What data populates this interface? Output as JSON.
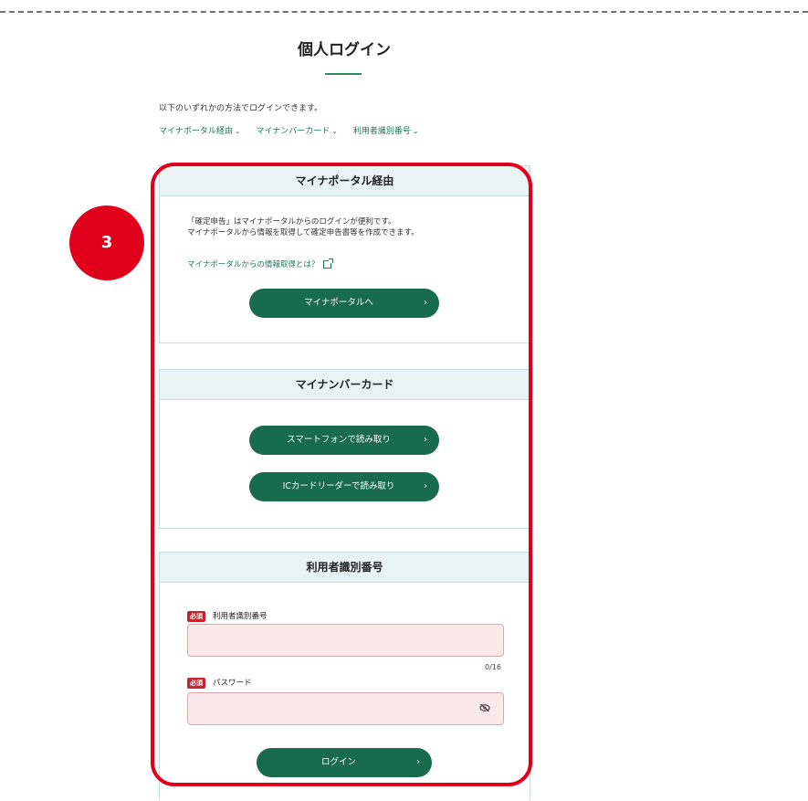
{
  "page": {
    "title": "個人ログイン",
    "intro": "以下のいずれかの方法でログインできます。",
    "quick_links": [
      "マイナポータル経由",
      "マイナンバーカード",
      "利用者識別番号"
    ]
  },
  "step_badge": "3",
  "mynaportal": {
    "header": "マイナポータル経由",
    "text_line1": "「確定申告」はマイナポータルからのログインが便利です。",
    "text_line2": "マイナポータルから情報を取得して確定申告書等を作成できます。",
    "link": "マイナポータルからの情報取得とは？",
    "button": "マイナポータルへ"
  },
  "mynumber": {
    "header": "マイナンバーカード",
    "button_smartphone": "スマートフォンで読み取り",
    "button_icreader": "ICカードリーダーで読み取り"
  },
  "userid": {
    "header": "利用者識別番号",
    "required": "必須",
    "id_label": "利用者識別番号",
    "id_counter": "0/16",
    "password_label": "パスワード",
    "login_button": "ログイン"
  },
  "icons": {
    "chevron": "›",
    "quicklink_chevron": "⌄",
    "eye": "eye-off-icon",
    "external": "external-link-icon"
  },
  "colors": {
    "primary": "#196b4e",
    "highlight": "#e1001b",
    "required": "#c8232c",
    "input_bg": "#fbe9e9"
  }
}
